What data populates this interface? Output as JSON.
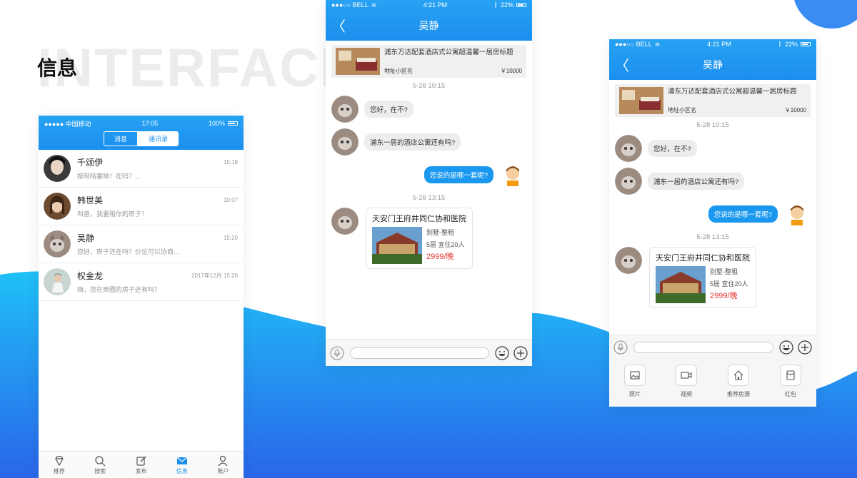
{
  "page": {
    "background_word": "INTERFACE",
    "section_title": "信息"
  },
  "colors": {
    "primary_blue": "#1b8fee",
    "price_red": "#e53935",
    "bubble_out": "#1a98f0"
  },
  "phone1": {
    "statusbar": {
      "carrier": "●●●●● 中国移动",
      "time": "17:05",
      "battery": "100%"
    },
    "segments": [
      "消息",
      "通讯录"
    ],
    "contacts": [
      {
        "name": "千颂伊",
        "time": "15:18",
        "message": "按呀哈塞呦！在吗？..."
      },
      {
        "name": "韩世美",
        "time": "10:07",
        "message": "叫兽，我要租你的房子！"
      },
      {
        "name": "吴静",
        "time": "15:20",
        "message": "您好，房子还在吗？价位可以协商..."
      },
      {
        "name": "权金龙",
        "time": "2017年12月 15:20",
        "message": "嗨，您在商圈的房子还有吗？"
      }
    ],
    "tabs": [
      {
        "label": "推荐",
        "icon": "diamond-icon"
      },
      {
        "label": "搜索",
        "icon": "search-icon"
      },
      {
        "label": "发布",
        "icon": "edit-icon"
      },
      {
        "label": "信息",
        "icon": "mail-icon"
      },
      {
        "label": "账户",
        "icon": "user-icon"
      }
    ]
  },
  "chat": {
    "statusbar": {
      "carrier": "●●●○○ BELL",
      "time": "4:21 PM",
      "battery": "22%"
    },
    "title": "吴静",
    "house": {
      "title": "浦东万达配套酒店式公寓超温馨一居房标题",
      "address": "地址小区名",
      "price": "￥10000"
    },
    "time1": "5-28 10:15",
    "messages": [
      "您好，在不?",
      "浦东一居的酒店公寓还有吗?",
      "您说的是哪一套呢?"
    ],
    "time2": "5-28 13:15",
    "hotel": {
      "name": "天安门王府井同仁协和医院",
      "type": "别墅-整租",
      "rooms": "5居  宜住20人",
      "price": "2999/晚"
    }
  },
  "extras": [
    {
      "label": "照片",
      "icon": "photo-icon"
    },
    {
      "label": "视频",
      "icon": "video-icon"
    },
    {
      "label": "推荐房源",
      "icon": "home-icon"
    },
    {
      "label": "红包",
      "icon": "red-packet-icon"
    }
  ]
}
